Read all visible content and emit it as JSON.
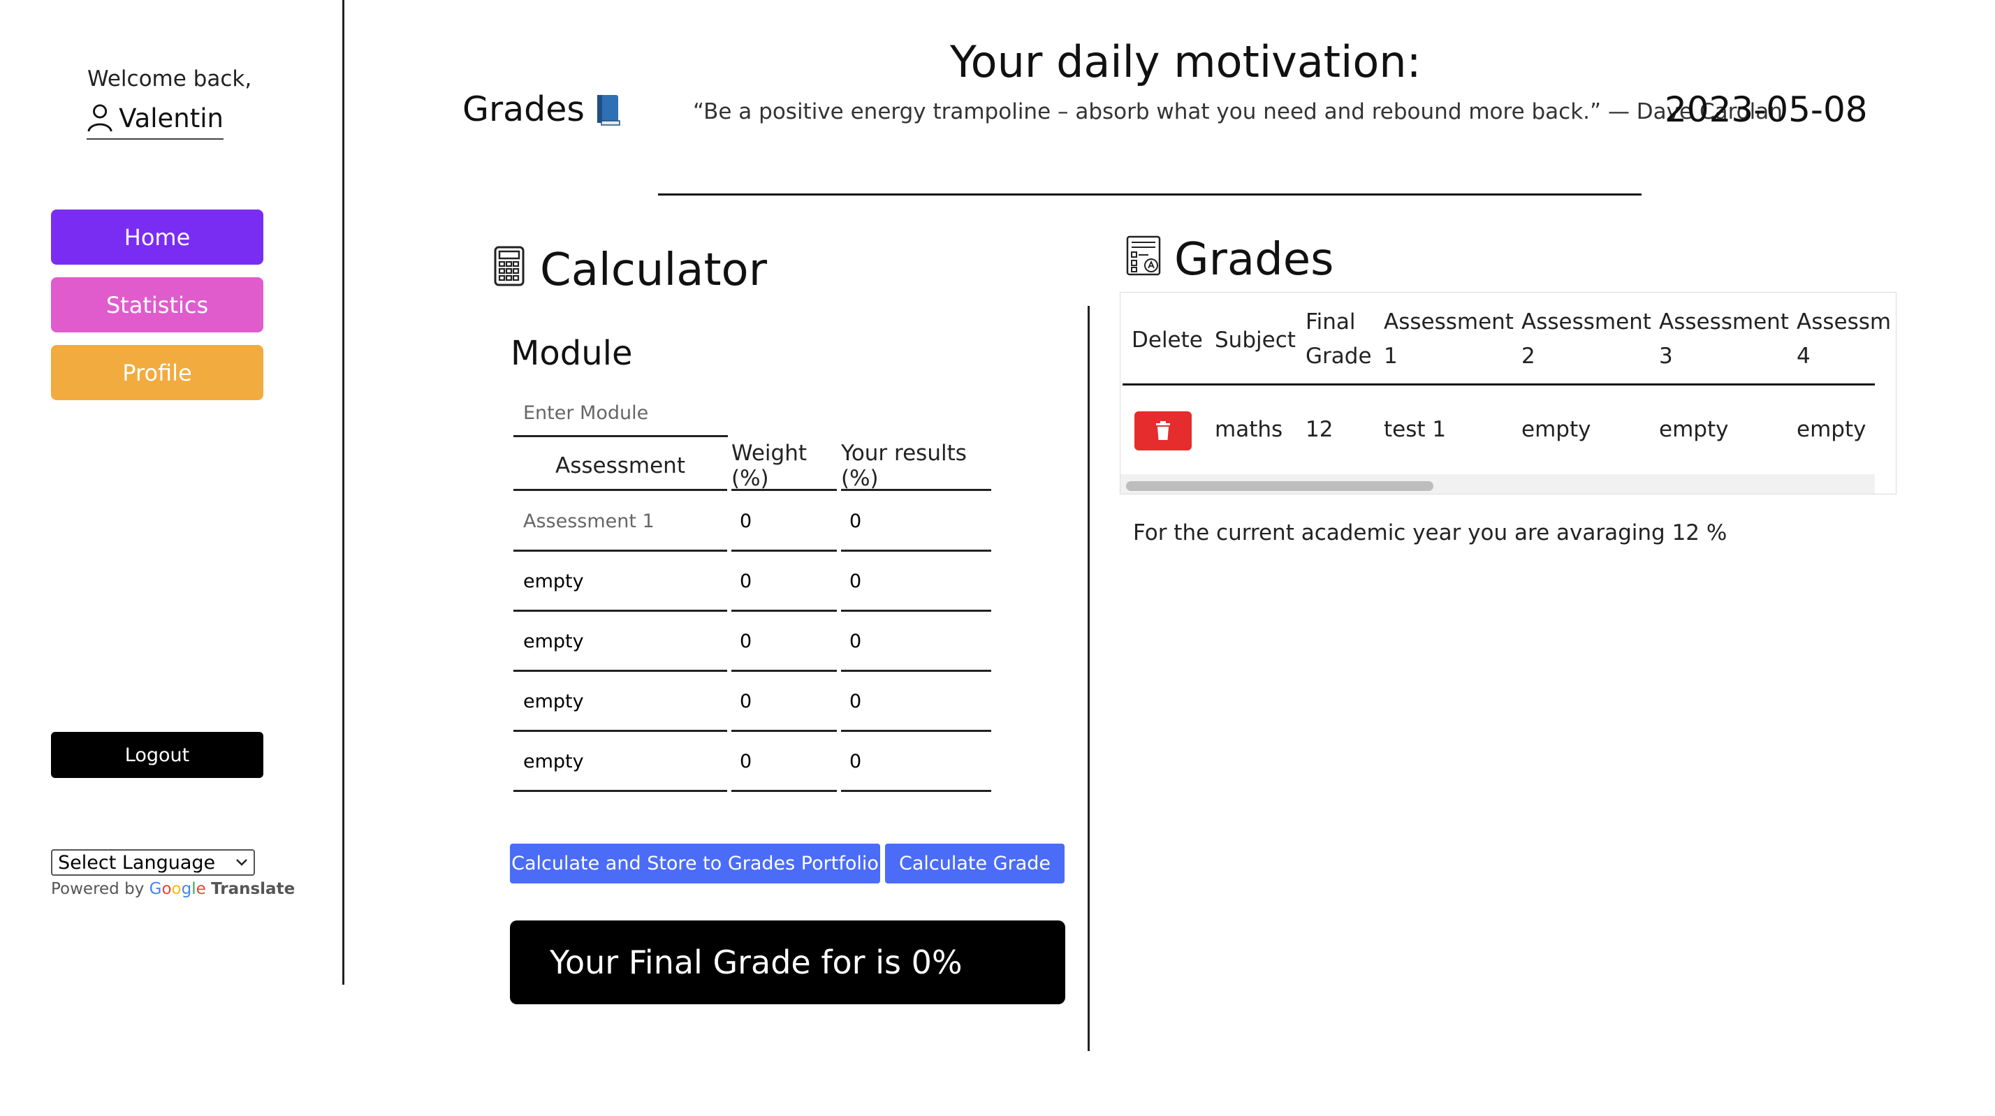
{
  "sidebar": {
    "welcome": "Welcome back,",
    "username": "Valentin",
    "nav": {
      "home": "Home",
      "statistics": "Statistics",
      "profile": "Profile"
    },
    "logout": "Logout",
    "language_select": "Select Language",
    "powered_by": "Powered by",
    "google_letters": [
      "G",
      "o",
      "o",
      "g",
      "l",
      "e"
    ],
    "translate": "Translate",
    "colors": {
      "home": "#7a2df2",
      "statistics": "#e05ccd",
      "profile": "#f2ab3f"
    }
  },
  "header": {
    "motivation_title": "Your daily motivation:",
    "page_heading": "Grades",
    "quote": "“Be a positive energy trampoline – absorb what you need and rebound more back.” — Dave Carolan",
    "date": "2023-05-08"
  },
  "calculator": {
    "title": "Calculator",
    "module_label": "Module",
    "module_placeholder": "Enter Module",
    "columns": {
      "assessment": "Assessment",
      "weight": "Weight (%)",
      "results": "Your results (%)"
    },
    "rows": [
      {
        "name": "Assessment 1",
        "weight": "0",
        "result": "0"
      },
      {
        "name": "empty",
        "weight": "0",
        "result": "0"
      },
      {
        "name": "empty",
        "weight": "0",
        "result": "0"
      },
      {
        "name": "empty",
        "weight": "0",
        "result": "0"
      },
      {
        "name": "empty",
        "weight": "0",
        "result": "0"
      }
    ],
    "store_button": "Calculate and Store to Grades Portfolio",
    "calc_button": "Calculate Grade",
    "final_grade_text": "Your Final Grade for is 0%"
  },
  "grades": {
    "title": "Grades",
    "headers": {
      "delete": "Delete",
      "subject": "Subject",
      "final_grade": [
        "Final",
        "Grade"
      ],
      "a1": [
        "Assessment",
        "1"
      ],
      "a2": [
        "Assessment",
        "2"
      ],
      "a3": [
        "Assessment",
        "3"
      ],
      "a4": [
        "Assessm",
        "4"
      ]
    },
    "row": {
      "subject": "maths",
      "final_grade": "12",
      "a1": "test 1",
      "a2": "empty",
      "a3": "empty",
      "a4": "empty"
    },
    "average_text": "For the current academic year you are avaraging 12 %"
  }
}
